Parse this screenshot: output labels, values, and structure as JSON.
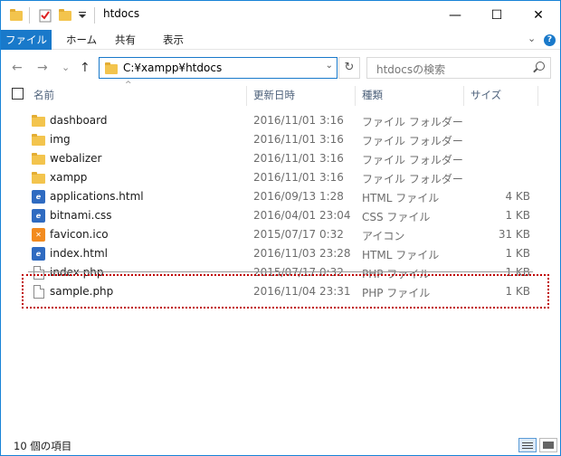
{
  "window": {
    "title": "htdocs",
    "controls": {
      "minimize": "—",
      "maximize": "☐",
      "close": "✕"
    }
  },
  "ribbon": {
    "tabs": [
      "ファイル",
      "ホーム",
      "共有",
      "表示"
    ],
    "expand_glyph": "⌄",
    "help_glyph": "?"
  },
  "nav": {
    "back_glyph": "←",
    "forward_glyph": "→",
    "recent_glyph": "⌄",
    "up_glyph": "↑",
    "address": "C:¥xampp¥htdocs",
    "address_dropdown_glyph": "⌄",
    "refresh_glyph": "↻",
    "search_placeholder": "htdocsの検索"
  },
  "columns": {
    "name": "名前",
    "date": "更新日時",
    "type": "種類",
    "size": "サイズ",
    "sort_glyph": "^"
  },
  "files": [
    {
      "icon": "folder-icon",
      "name": "dashboard",
      "date": "2016/11/01 3:16",
      "type": "ファイル フォルダー",
      "size": ""
    },
    {
      "icon": "folder-icon",
      "name": "img",
      "date": "2016/11/01 3:16",
      "type": "ファイル フォルダー",
      "size": ""
    },
    {
      "icon": "folder-icon",
      "name": "webalizer",
      "date": "2016/11/01 3:16",
      "type": "ファイル フォルダー",
      "size": ""
    },
    {
      "icon": "folder-icon",
      "name": "xampp",
      "date": "2016/11/01 3:16",
      "type": "ファイル フォルダー",
      "size": ""
    },
    {
      "icon": "html-file-icon",
      "name": "applications.html",
      "date": "2016/09/13 1:28",
      "type": "HTML ファイル",
      "size": "4 KB"
    },
    {
      "icon": "css-file-icon",
      "name": "bitnami.css",
      "date": "2016/04/01 23:04",
      "type": "CSS ファイル",
      "size": "1 KB"
    },
    {
      "icon": "ico-file-icon",
      "name": "favicon.ico",
      "date": "2015/07/17 0:32",
      "type": "アイコン",
      "size": "31 KB"
    },
    {
      "icon": "html-file-icon",
      "name": "index.html",
      "date": "2016/11/03 23:28",
      "type": "HTML ファイル",
      "size": "1 KB"
    },
    {
      "icon": "php-file-icon",
      "name": "index.php",
      "date": "2015/07/17 0:32",
      "type": "PHP ファイル",
      "size": "1 KB",
      "struck": true
    },
    {
      "icon": "php-file-icon",
      "name": "sample.php",
      "date": "2016/11/04 23:31",
      "type": "PHP ファイル",
      "size": "1 KB"
    }
  ],
  "status": {
    "item_count": "10 個の項目"
  },
  "colors": {
    "accent": "#1979ca",
    "highlight_border": "#c00000",
    "folder": "#f3c44d"
  }
}
